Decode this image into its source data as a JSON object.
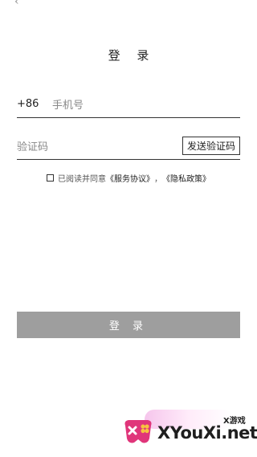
{
  "header": {
    "title": "登 录"
  },
  "phone": {
    "country_code": "+86",
    "placeholder": "手机号",
    "value": ""
  },
  "verification": {
    "placeholder": "验证码",
    "value": "",
    "send_button_label": "发送验证码"
  },
  "agreement": {
    "checked": false,
    "prefix": "已阅读并同意",
    "service_link": "《服务协议》",
    "separator": "，",
    "privacy_link": "《隐私政策》"
  },
  "login_button": {
    "label": "登 录",
    "color": "#9e9e9e"
  },
  "watermark": {
    "small_text": "X游戏",
    "text": "XYouXi.net"
  }
}
